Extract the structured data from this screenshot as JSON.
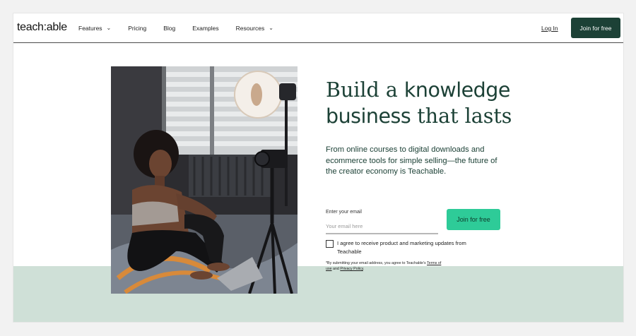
{
  "header": {
    "logo": "teach:able",
    "nav": [
      {
        "label": "Features",
        "has_dropdown": true
      },
      {
        "label": "Pricing",
        "has_dropdown": false
      },
      {
        "label": "Blog",
        "has_dropdown": false
      },
      {
        "label": "Examples",
        "has_dropdown": false
      },
      {
        "label": "Resources",
        "has_dropdown": true
      }
    ],
    "login": "Log In",
    "join": "Join for free"
  },
  "hero": {
    "headline_part1": "Build a ",
    "headline_part2": "knowledge",
    "headline_part3": "business",
    "headline_part4": " that lasts",
    "subtext": "From online courses to digital downloads and ecommerce tools for simple selling—the future of the creator economy is Teachable.",
    "email_label": "Enter your email",
    "email_placeholder": "Your email here",
    "email_value": "",
    "join_button": "Join for free",
    "consent": "I agree to receive product and marketing updates from Teachable",
    "consent_checked": false,
    "fine_print_1": "*By submitting your email address, you agree to Teachable's ",
    "terms_link": "Terms of use",
    "fine_print_2": " and ",
    "privacy_link": "Privacy Policy",
    "fine_print_3": "."
  },
  "colors": {
    "brand_dark": "#1c4136",
    "cta_green": "#2ecb98",
    "band": "#cfe0d7"
  },
  "icons": {
    "dropdown": "chevron-down-icon",
    "photo": "creator-filming-photo"
  }
}
